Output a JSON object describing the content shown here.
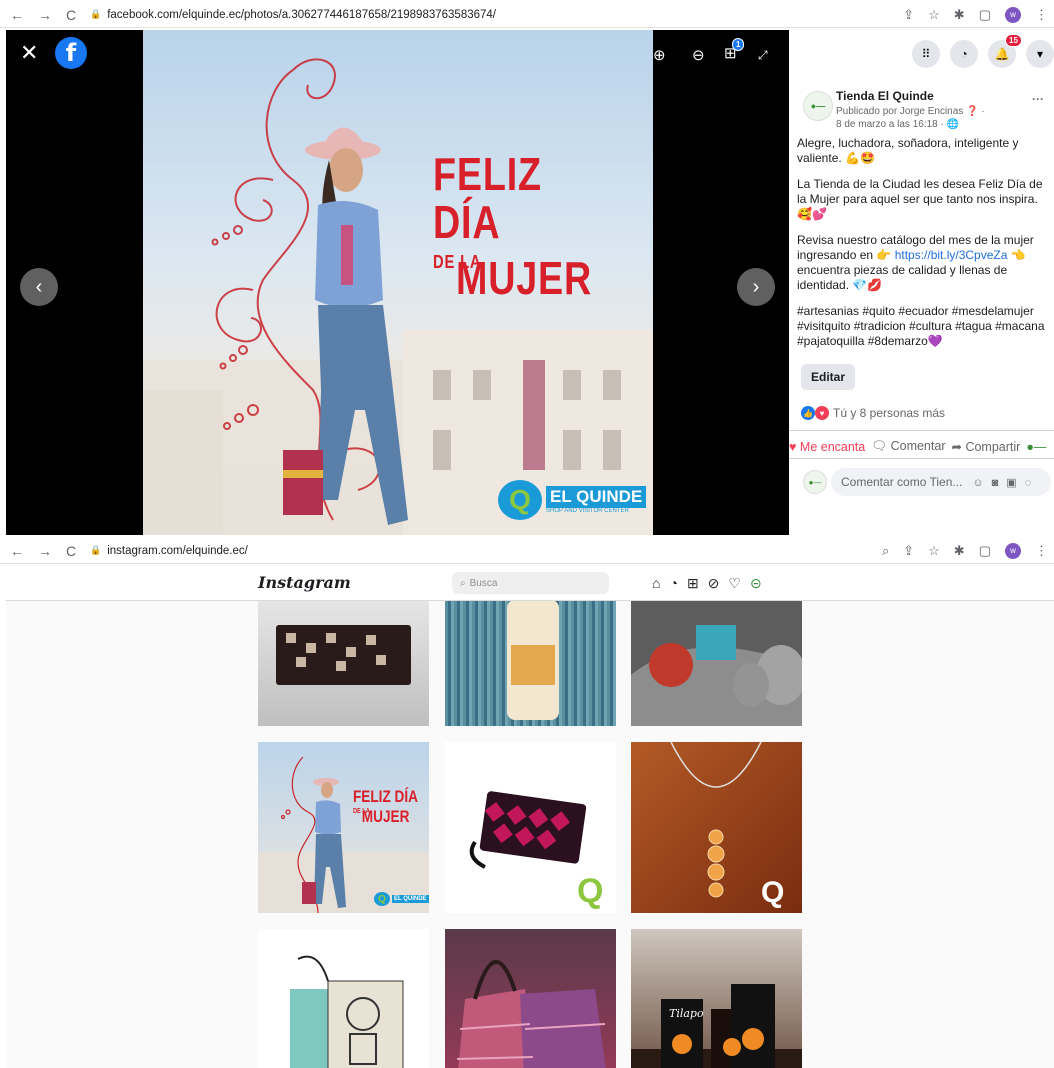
{
  "fb_browser": {
    "url": "facebook.com/elquinde.ec/photos/a.306277446187658/2198983763583674/"
  },
  "ig_browser": {
    "url": "instagram.com/elquinde.ec/"
  },
  "browser": {
    "avatar_letter": "w"
  },
  "fb": {
    "notif_badge": "15",
    "viewer_badge": "1",
    "photo": {
      "line1": "FELIZ DÍA",
      "line2_small": "DE LA",
      "line2": "MUJER",
      "logo": "EL QUINDE",
      "logo_sub": "SHOP AND VISITOR CENTER"
    },
    "page_name": "Tienda El Quinde",
    "published_by": "Publicado por Jorge Encinas",
    "date": "8 de marzo a las 16:18",
    "paragraphs": [
      "Alegre, luchadora, soñadora, inteligente y valiente. 💪🤩",
      "La Tienda de la Ciudad les desea Feliz Día de la Mujer para aquel ser que tanto nos inspira. 🥰💕"
    ],
    "catalog_pre": "Revisa nuestro catálogo del mes de la mujer ingresando en 👉",
    "catalog_link": "https://bit.ly/3CpveZa",
    "catalog_post": "👈 encuentra piezas de calidad y llenas de identidad. 💎💋",
    "hashtags": "#artesanias #quito #ecuador #mesdelamujer #visitquito #tradicion #cultura #tagua #macana #pajatoquilla #8demarzo💜",
    "edit_label": "Editar",
    "reactions": "Tú y 8 personas más",
    "love_label": "Me encanta",
    "comment_label": "Comentar",
    "share_label": "Compartir",
    "comment_placeholder": "Comentar como Tien..."
  },
  "ig": {
    "logo": "Instagram",
    "search_placeholder": "Busca",
    "tile4": {
      "line1": "FELIZ DÍA",
      "line2_small": "DE LA",
      "line2": "MUJER",
      "logo": "EL QUINDE"
    },
    "tile9_brand": "Tilapo"
  },
  "colors": {
    "fb_blue": "#1877f2",
    "red_title": "#d8202a",
    "love": "#f33e58"
  }
}
